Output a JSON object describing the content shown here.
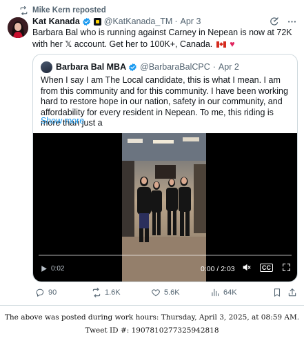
{
  "repost": {
    "label": "Mike Kern reposted"
  },
  "tweet": {
    "author_name": "Kat Kanada",
    "handle": "@KatKanada_TM",
    "separator": "·",
    "date": "Apr 3",
    "text": "Barbara Bal who is running against Carney in Nepean is now at 72K with her 𝕏 account. Get her to 100K+, Canada.",
    "emoji_flag": "canadian-flag",
    "emoji_heart": "♥"
  },
  "quote": {
    "author_name": "Barbara Bal MBA",
    "handle": "@BarbaraBalCPC",
    "separator": "·",
    "date": "Apr 2",
    "text": "When I say I am The Local candidate, this is what I mean. I am from this community and for this community. I have been working hard to restore hope in our nation, safety in our community, and affordability for every resident in Nepean. To me, this riding is more than just a",
    "show_more": "Show more",
    "video": {
      "elapsed_left": "0:02",
      "time_display": "0:00 / 2:03",
      "progress": 0.0,
      "captions_label": "CC"
    }
  },
  "actions": {
    "replies": "90",
    "reposts": "1.6K",
    "likes": "5.6K",
    "views": "64K"
  },
  "caption": {
    "line1": "The above was posted during work hours: Thursday, April 3, 2025, at 08:59 AM.",
    "line2": "Tweet ID #: 1907810277325942818"
  },
  "colors": {
    "accent": "#1d9bf0",
    "muted": "#536471",
    "border": "#cfd9de",
    "heart": "#e0245e"
  }
}
